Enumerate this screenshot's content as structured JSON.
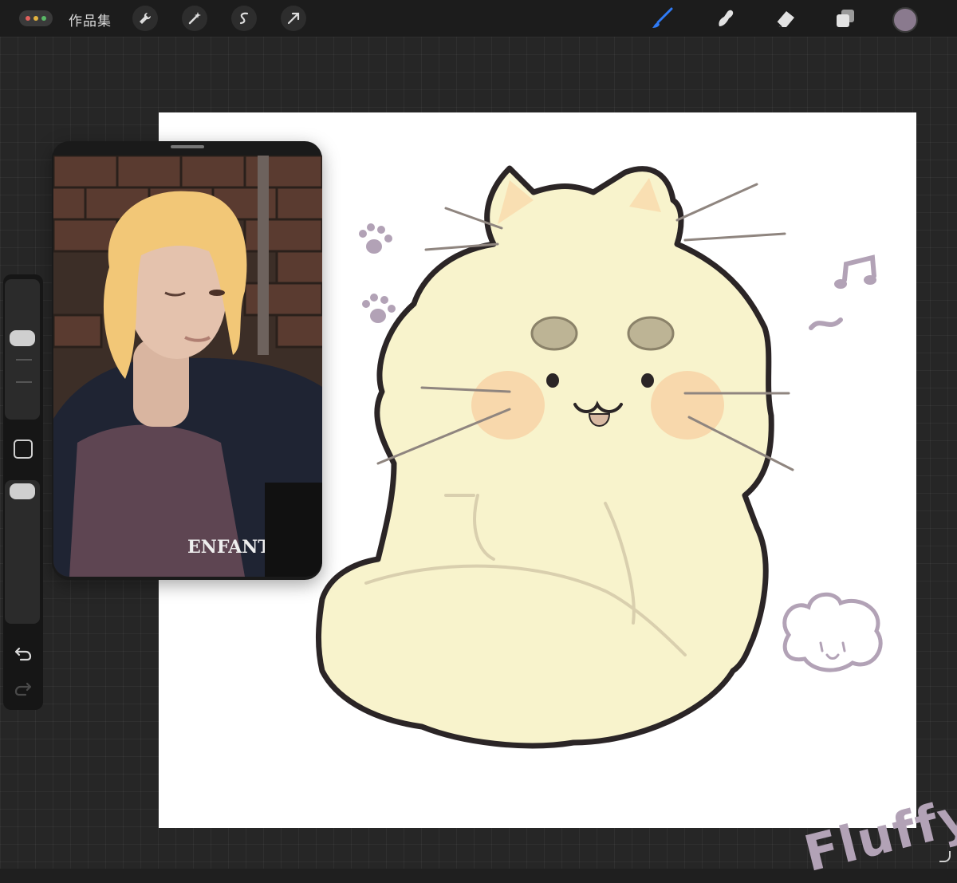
{
  "toolbar": {
    "gallery_label": "作品集",
    "menu_dots_colors": [
      "#e0605c",
      "#e3b33f",
      "#59b866"
    ],
    "left_tools": [
      "wrench-icon",
      "magic-wand-icon",
      "selection-icon",
      "transform-icon"
    ],
    "right_tools": [
      "brush-icon",
      "smudge-icon",
      "eraser-icon",
      "layers-icon"
    ],
    "active_tool": "brush-icon",
    "active_color": "#8a7a8e",
    "accent": "#2f7bf6"
  },
  "sidebar": {
    "controls": [
      "brush-size-slider",
      "modify-button",
      "opacity-slider",
      "undo-icon",
      "redo-icon"
    ]
  },
  "reference": {
    "content": "photo-reference",
    "shirt_text": "ENFANT"
  },
  "canvas": {
    "annotation": "Fluffy...",
    "colors": {
      "body": "#f8f3cc",
      "outline": "#2b2526",
      "cheeks": "#f7d5a8",
      "eyebrows": "#bdb495",
      "decor": "#b2a2b6"
    }
  }
}
